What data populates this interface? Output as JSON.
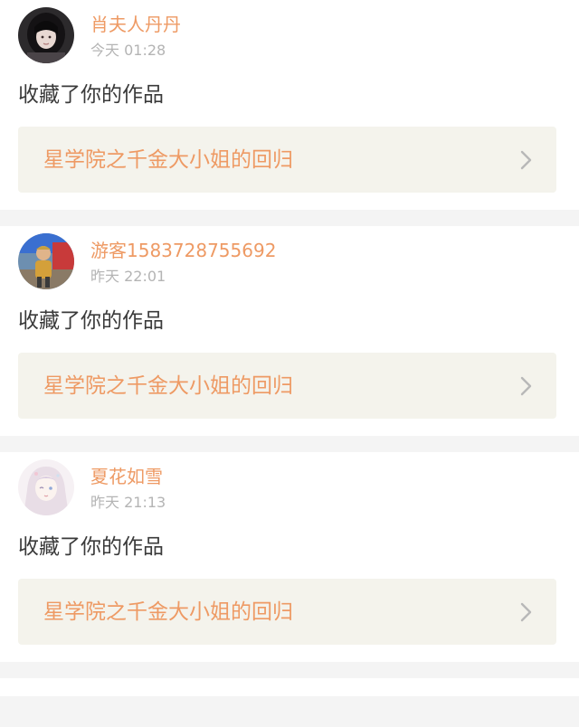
{
  "notifications": [
    {
      "username": "肖夫人丹丹",
      "time": "今天 01:28",
      "action": "收藏了你的作品",
      "work_title": "星学院之千金大小姐的回归",
      "avatar_icon": "avatar-dark-hair-girl"
    },
    {
      "username": "游客1583728755692",
      "time": "昨天 22:01",
      "action": "收藏了你的作品",
      "work_title": "星学院之千金大小姐的回归",
      "avatar_icon": "avatar-child-photo"
    },
    {
      "username": "夏花如雪",
      "time": "昨天 21:13",
      "action": "收藏了你的作品",
      "work_title": "星学院之千金大小姐的回归",
      "avatar_icon": "avatar-anime-girl"
    }
  ],
  "colors": {
    "accent": "#ee9a64",
    "muted": "#b4b4b4",
    "text": "#3a3a3a",
    "link_bg": "#f4f3ec",
    "page_bg": "#f4f4f4"
  },
  "icons": {
    "chevron": "chevron-right-icon"
  }
}
